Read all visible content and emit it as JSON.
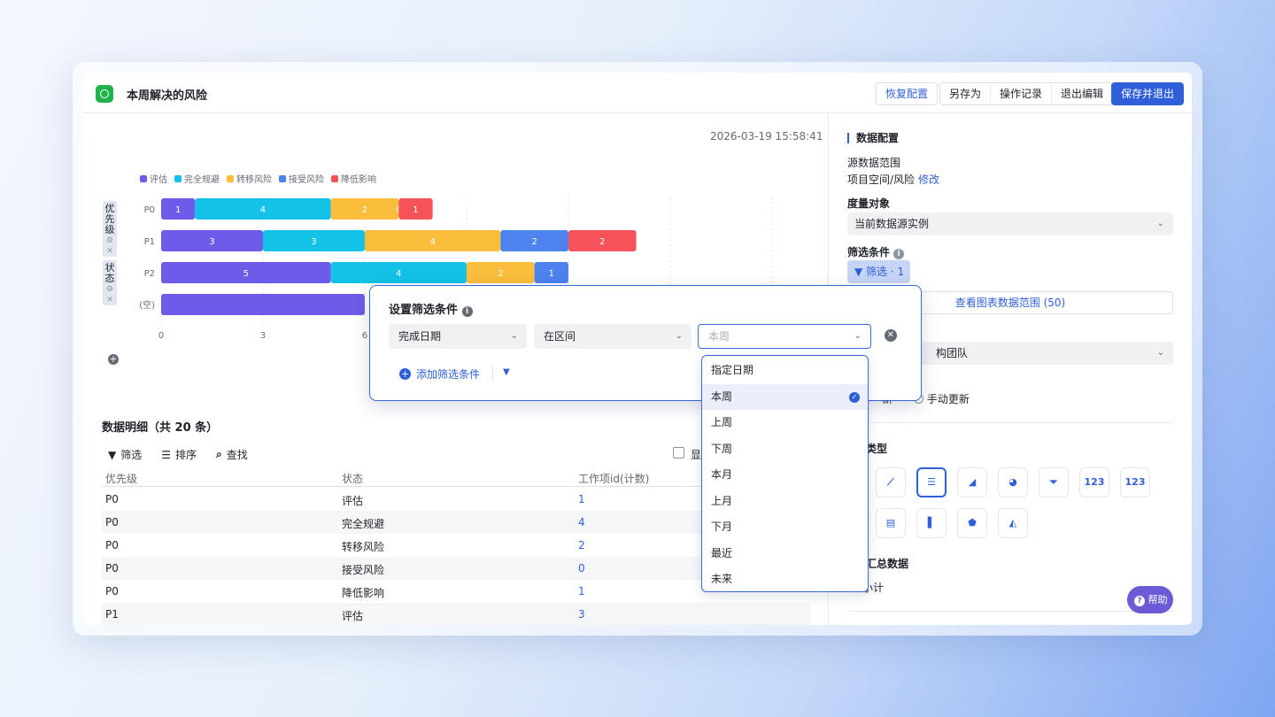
{
  "header": {
    "title": "本周解决的风险",
    "restore_label": "恢复配置",
    "save_as_label": "另存为",
    "log_label": "操作记录",
    "exit_label": "退出编辑",
    "save_exit_label": "保存并退出"
  },
  "timestamp": "2026-03-19 15:58:41",
  "dimension_tags": [
    {
      "label": "优先级"
    },
    {
      "label": "状态"
    }
  ],
  "chart_data": {
    "type": "bar",
    "orientation": "horizontal",
    "stacked": true,
    "categories": [
      "P0",
      "P1",
      "P2",
      "(空)"
    ],
    "series": [
      {
        "name": "评估",
        "color": "#6c5ce7",
        "values": [
          1,
          3,
          5,
          6
        ]
      },
      {
        "name": "完全规避",
        "color": "#13c2e6",
        "values": [
          4,
          3,
          4,
          0
        ]
      },
      {
        "name": "转移风险",
        "color": "#fbbd3c",
        "values": [
          2,
          4,
          2,
          0
        ]
      },
      {
        "name": "接受风险",
        "color": "#4d82ef",
        "values": [
          0,
          2,
          1,
          0
        ]
      },
      {
        "name": "降低影响",
        "color": "#f5525a",
        "values": [
          1,
          2,
          0,
          0
        ]
      }
    ],
    "xticks": [
      "0",
      "3",
      "6"
    ],
    "xlim": [
      0,
      18
    ],
    "legend_position": "top-left",
    "grid": true
  },
  "table": {
    "title": "数据明细（共 20 条）",
    "tools": {
      "filter": "筛选",
      "sort": "排序",
      "find": "查找"
    },
    "checkbox_label": "显",
    "columns": [
      "优先级",
      "状态",
      "工作项id(计数)"
    ],
    "rows": [
      [
        "P0",
        "评估",
        "1"
      ],
      [
        "P0",
        "完全规避",
        "4"
      ],
      [
        "P0",
        "转移风险",
        "2"
      ],
      [
        "P0",
        "接受风险",
        "0"
      ],
      [
        "P0",
        "降低影响",
        "1"
      ],
      [
        "P1",
        "评估",
        "3"
      ]
    ]
  },
  "panel": {
    "section_title": "数据配置",
    "source_label": "源数据范围",
    "source_value": "项目空间/风险",
    "source_edit": "修改",
    "measure_label": "度量对象",
    "measure_value": "当前数据源实例",
    "filter_label": "筛选条件",
    "filter_chip": "筛选 · 1",
    "range_button": "查看图表数据范围 (50)",
    "team_value": "构团队",
    "update_partial": "新",
    "manual_update": "手动更新",
    "chart_type_label": "表类型",
    "summary_label": "示汇总数据",
    "subtotal_label": "小计",
    "chart_type_icons": [
      "bar-icon",
      "line-icon",
      "stacked-bar-icon",
      "area-icon",
      "pie-icon",
      "funnel-icon",
      "kpi-icon",
      "number-icon",
      "table-icon",
      "pivot-icon",
      "waterfall-icon",
      "radar-icon",
      "mixed-icon"
    ],
    "number_icon_text": "123",
    "help_label": "帮助"
  },
  "filter_dialog": {
    "title": "设置筛选条件",
    "field": "完成日期",
    "operator": "在区间",
    "value_placeholder": "本周",
    "add_condition": "添加筛选条件"
  },
  "dropdown": {
    "options": [
      "指定日期",
      "本周",
      "上周",
      "下周",
      "本月",
      "上月",
      "下月",
      "最近",
      "未来"
    ],
    "selected": "本周"
  }
}
